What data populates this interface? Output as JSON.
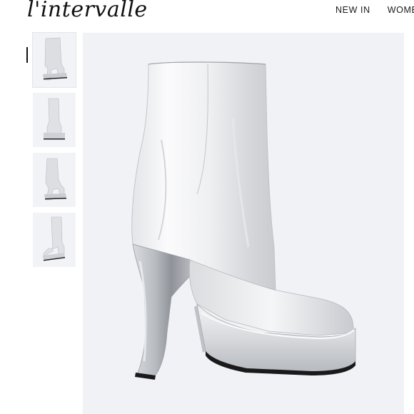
{
  "brand": {
    "logo_text": "l'intervalle"
  },
  "nav": {
    "items": [
      "NEW IN",
      "WOME"
    ]
  },
  "product": {
    "image_icon": "silver-platform-boot",
    "thumbnail_count": 4,
    "active_thumbnail": 1
  },
  "colors": {
    "page_background": "#ffffff",
    "image_background": "#f1f2f6",
    "boot_silver_light": "#fafafb",
    "boot_silver_mid": "#d3d5d9",
    "boot_silver_dark": "#8d9096",
    "sole_black": "#1a1a1a"
  }
}
